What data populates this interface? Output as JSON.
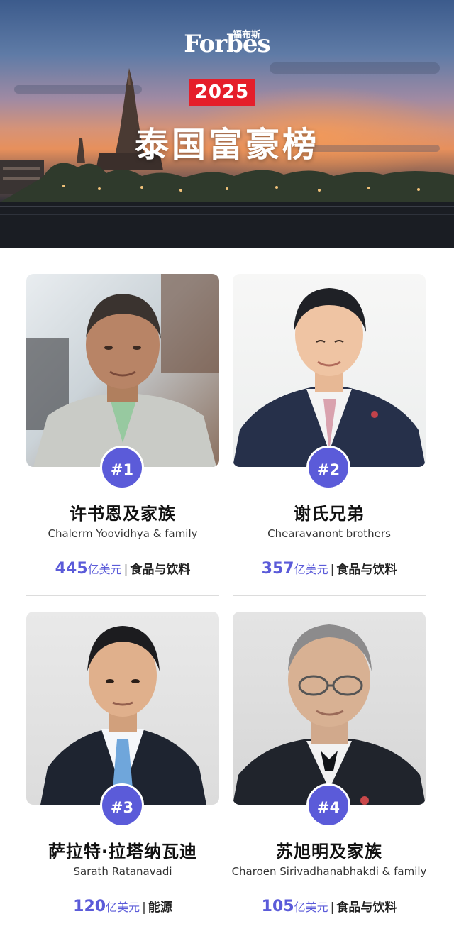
{
  "header": {
    "brand": "Forbes",
    "brand_cn": "福布斯",
    "year": "2025",
    "title": "泰国富豪榜"
  },
  "entries": [
    {
      "rank": "#1",
      "name_cn": "许书恩及家族",
      "name_en": "Chalerm Yoovidhya & family",
      "net_worth": "445",
      "unit": "亿美元",
      "separator": "|",
      "industry": "食品与饮料"
    },
    {
      "rank": "#2",
      "name_cn": "谢氏兄弟",
      "name_en": "Chearavanont brothers",
      "net_worth": "357",
      "unit": "亿美元",
      "separator": "|",
      "industry": "食品与饮料"
    },
    {
      "rank": "#3",
      "name_cn": "萨拉特·拉塔纳瓦迪",
      "name_en": "Sarath Ratanavadi",
      "net_worth": "120",
      "unit": "亿美元",
      "separator": "|",
      "industry": "能源"
    },
    {
      "rank": "#4",
      "name_cn": "苏旭明及家族",
      "name_en": "Charoen Sirivadhanabhakdi & family",
      "net_worth": "105",
      "unit": "亿美元",
      "separator": "|",
      "industry": "食品与饮料"
    }
  ],
  "colors": {
    "accent": "#5b5bd9",
    "badge_red": "#e51e2a"
  }
}
